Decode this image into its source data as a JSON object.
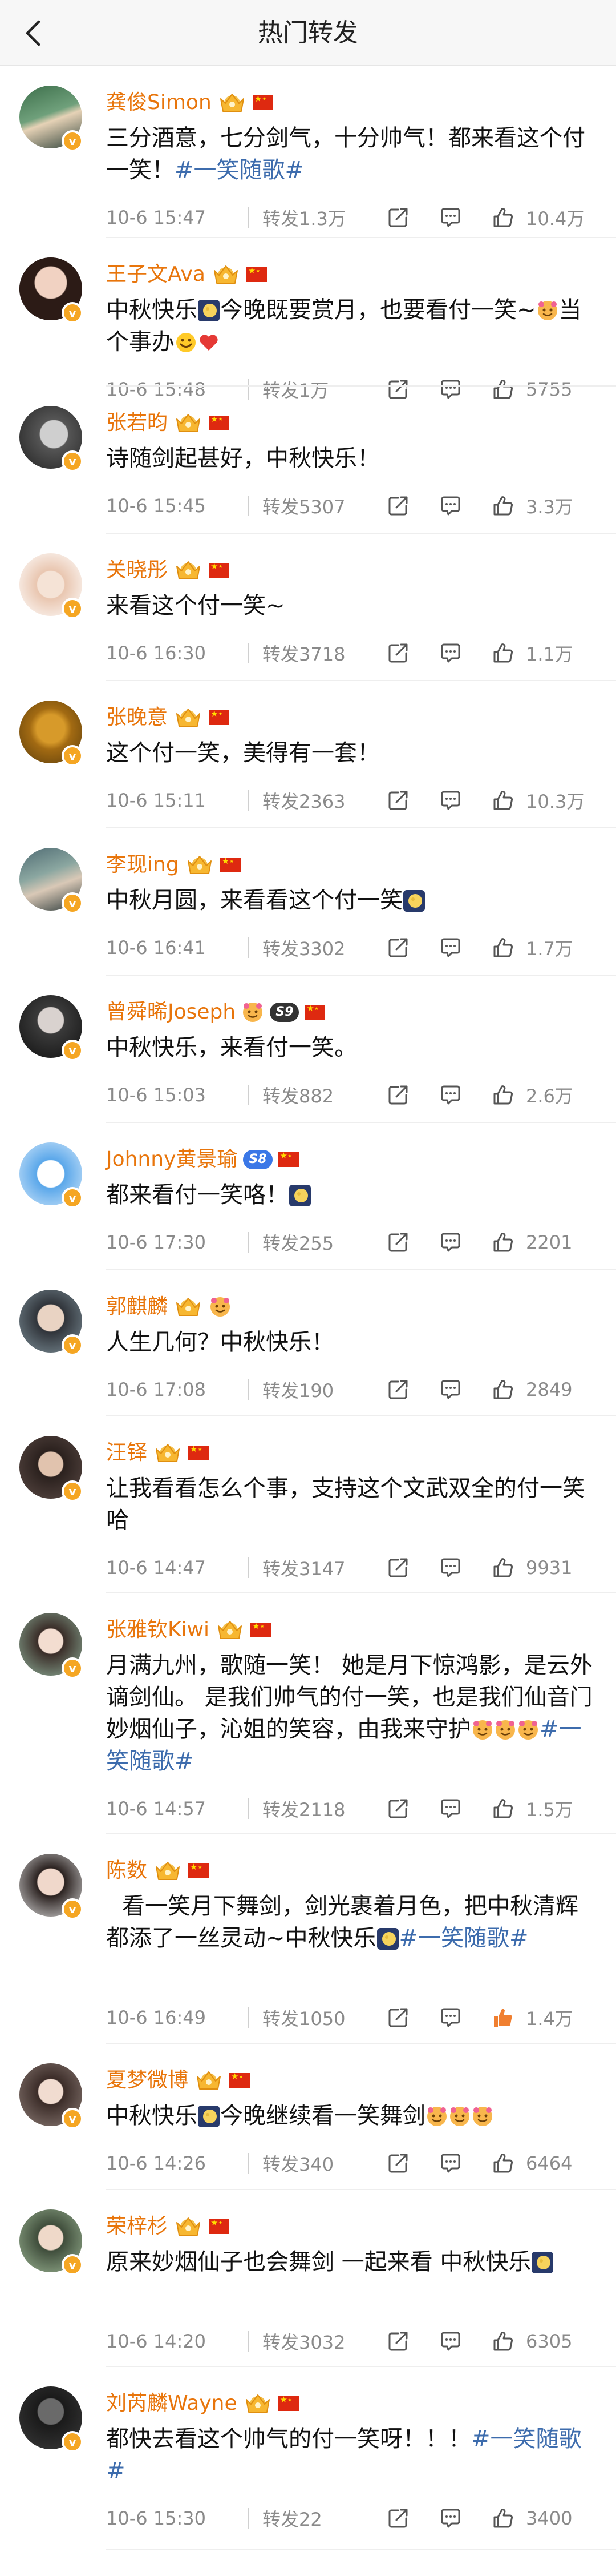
{
  "header": {
    "title": "热门转发"
  },
  "icons": {
    "back": "back-arrow-icon",
    "share": "share-icon",
    "comment": "comment-icon",
    "like": "thumbs-up-icon",
    "verified": "verified-v-icon",
    "crown": "crown-level-icon",
    "flag": "china-flag-icon"
  },
  "colors": {
    "username": "#e8750b",
    "hashtag": "#3d6cad",
    "meta": "#8a8a8a",
    "verified": "#f5a623",
    "liked": "#f07f30"
  },
  "posts": [
    {
      "username": "龚俊Simon",
      "content": "三分酒意，七分剑气，十分帅气！都来看这个付一笑！",
      "hashtag": "#一笑随歌#",
      "time": "10-6 15:47",
      "repost": "转发1.3万",
      "likes": "10.4万"
    },
    {
      "username": "王子文Ava",
      "content_a": "中秋快乐",
      "content_b": "今晚既要赏月，也要看付一笑~",
      "content_c": "当个事办",
      "time": "10-6 15:48",
      "repost": "转发1万",
      "likes": "5755"
    },
    {
      "username": "张若昀",
      "content": "诗随剑起甚好，中秋快乐！",
      "time": "10-6 15:45",
      "repost": "转发5307",
      "likes": "3.3万"
    },
    {
      "username": "关晓彤",
      "content": "来看这个付一笑~",
      "time": "10-6 16:30",
      "repost": "转发3718",
      "likes": "1.1万"
    },
    {
      "username": "张晚意",
      "content": "这个付一笑，美得有一套！",
      "time": "10-6 15:11",
      "repost": "转发2363",
      "likes": "10.3万"
    },
    {
      "username": "李现ing",
      "content": "中秋月圆，来看看这个付一笑",
      "time": "10-6 16:41",
      "repost": "转发3302",
      "likes": "1.7万"
    },
    {
      "username": "曾舜晞Joseph",
      "badge": "S9",
      "content": "中秋快乐，来看付一笑。",
      "time": "10-6 15:03",
      "repost": "转发882",
      "likes": "2.6万"
    },
    {
      "username": "Johnny黄景瑜",
      "badge": "S8",
      "content": "都来看付一笑咯！",
      "time": "10-6 17:30",
      "repost": "转发255",
      "likes": "2201"
    },
    {
      "username": "郭麒麟",
      "content": "人生几何？中秋快乐！",
      "time": "10-6 17:08",
      "repost": "转发190",
      "likes": "2849"
    },
    {
      "username": "汪铎",
      "content": "让我看看怎么个事，支持这个文武双全的付一笑哈",
      "time": "10-6 14:47",
      "repost": "转发3147",
      "likes": "9931"
    },
    {
      "username": "张雅钦Kiwi",
      "content": "月满九州，歌随一笑！ 她是月下惊鸿影，是云外谪剑仙。 是我们帅气的付一笑，也是我们仙音门妙烟仙子，沁姐的笑容，由我来守护",
      "hashtag": "#一笑随歌#",
      "time": "10-6 14:57",
      "repost": "转发2118",
      "likes": "1.5万"
    },
    {
      "username": "陈数",
      "content": "看一笑月下舞剑，剑光裹着月色，把中秋清辉都添了一丝灵动~中秋快乐",
      "hashtag": "#一笑随歌#",
      "time": "10-6 16:49",
      "repost": "转发1050",
      "likes": "1.4万"
    },
    {
      "username": "夏梦微博",
      "content_a": "中秋快乐",
      "content_b": "今晚继续看一笑舞剑",
      "time": "10-6 14:26",
      "repost": "转发340",
      "likes": "6464"
    },
    {
      "username": "荣梓杉",
      "content": "原来妙烟仙子也会舞剑 一起来看 中秋快乐",
      "time": "10-6 14:20",
      "repost": "转发3032",
      "likes": "6305"
    },
    {
      "username": "刘芮麟Wayne",
      "content": "都快去看这个帅气的付一笑呀！！！",
      "hashtag": "#一笑随歌#",
      "time": "10-6 15:30",
      "repost": "转发22",
      "likes": "3400"
    }
  ]
}
